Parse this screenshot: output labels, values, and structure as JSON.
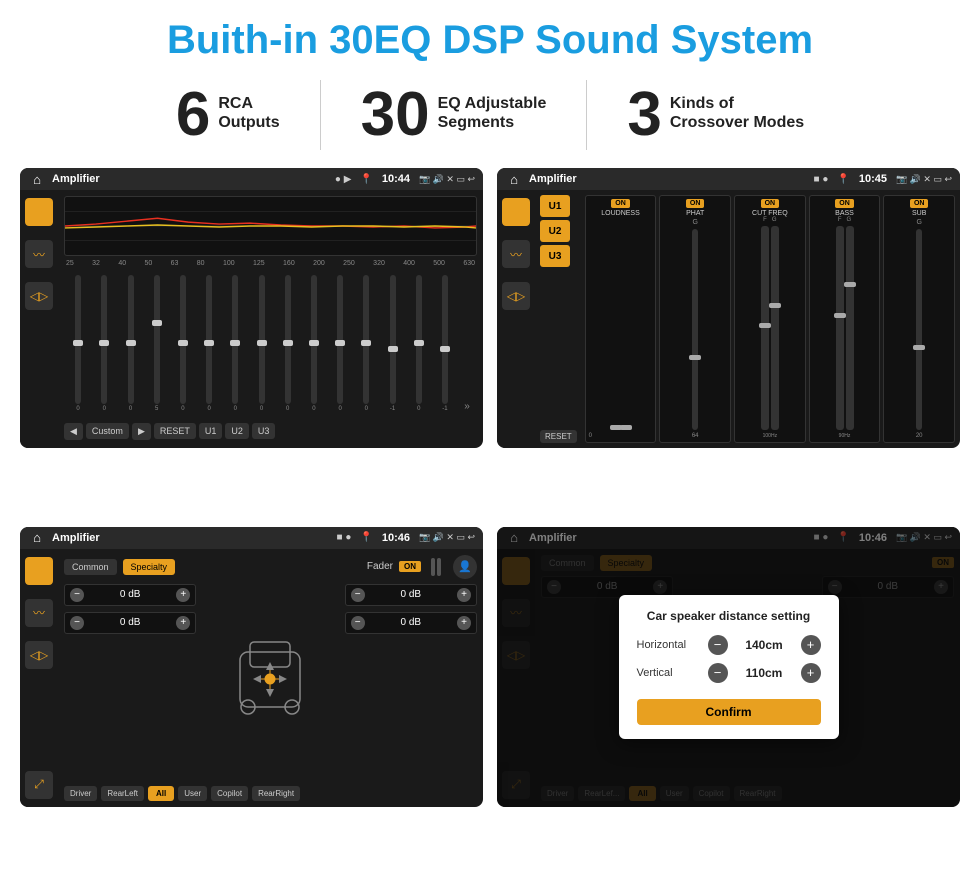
{
  "page": {
    "title": "Buith-in 30EQ DSP Sound System",
    "stats": [
      {
        "number": "6",
        "label": "RCA",
        "sublabel": "Outputs"
      },
      {
        "number": "30",
        "label": "EQ Adjustable",
        "sublabel": "Segments"
      },
      {
        "number": "3",
        "label": "Kinds of",
        "sublabel": "Crossover Modes"
      }
    ],
    "screens": [
      {
        "id": "eq-screen",
        "status_bar": {
          "icon": "🏠",
          "title": "Amplifier",
          "time": "10:44",
          "dots": "● ▶"
        },
        "eq_labels": [
          "25",
          "32",
          "40",
          "50",
          "63",
          "80",
          "100",
          "125",
          "160",
          "200",
          "250",
          "320",
          "400",
          "500",
          "630"
        ],
        "eq_values": [
          "0",
          "0",
          "0",
          "5",
          "0",
          "0",
          "0",
          "0",
          "0",
          "0",
          "0",
          "0",
          "-1",
          "0",
          "-1"
        ],
        "bottom_buttons": [
          "◀",
          "Custom",
          "▶",
          "RESET",
          "U1",
          "U2",
          "U3"
        ]
      },
      {
        "id": "amp-modes-screen",
        "status_bar": {
          "icon": "🏠",
          "title": "Amplifier",
          "time": "10:45",
          "dots": "■ ●"
        },
        "channels": [
          "U1",
          "U2",
          "U3"
        ],
        "controls": [
          "LOUDNESS",
          "PHAT",
          "CUT FREQ",
          "BASS",
          "SUB"
        ],
        "reset_label": "RESET"
      },
      {
        "id": "fader-screen",
        "status_bar": {
          "icon": "🏠",
          "title": "Amplifier",
          "time": "10:46",
          "dots": "■ ●"
        },
        "tabs": [
          "Common",
          "Specialty"
        ],
        "fader_label": "Fader",
        "fader_on": "ON",
        "db_values": [
          "0 dB",
          "0 dB",
          "0 dB",
          "0 dB"
        ],
        "bottom_buttons": [
          "Driver",
          "RearLeft",
          "All",
          "User",
          "Copilot",
          "RearRight"
        ]
      },
      {
        "id": "dialog-screen",
        "status_bar": {
          "icon": "🏠",
          "title": "Amplifier",
          "time": "10:46",
          "dots": "■ ●"
        },
        "dialog": {
          "title": "Car speaker distance setting",
          "horizontal_label": "Horizontal",
          "horizontal_value": "140cm",
          "vertical_label": "Vertical",
          "vertical_value": "110cm",
          "confirm_label": "Confirm"
        },
        "tabs": [
          "Common",
          "Specialty"
        ],
        "db_values": [
          "0 dB",
          "0 dB"
        ],
        "bottom_buttons": [
          "Driver",
          "RearLef...",
          "All",
          "User",
          "Copilot",
          "RearRight"
        ]
      }
    ]
  }
}
